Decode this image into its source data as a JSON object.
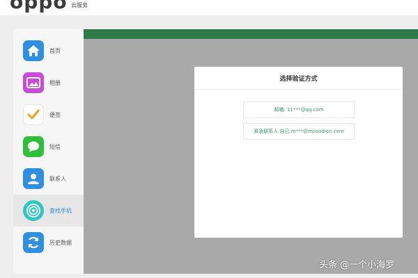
{
  "header": {
    "logo": "oppo",
    "subtitle": "云服务"
  },
  "sidebar": {
    "items": [
      {
        "label": "首页",
        "icon": "home-icon",
        "color": "#2f8fe0"
      },
      {
        "label": "相册",
        "icon": "photo-icon",
        "color": "#c94bd8"
      },
      {
        "label": "便签",
        "icon": "note-check-icon",
        "color": "#ffffff"
      },
      {
        "label": "短信",
        "icon": "message-icon",
        "color": "#2fbf3a"
      },
      {
        "label": "联系人",
        "icon": "contact-icon",
        "color": "#2f8fe0"
      },
      {
        "label": "查找手机",
        "icon": "find-phone-icon",
        "color": "#2fc7c4",
        "active": true
      },
      {
        "label": "历史数据",
        "icon": "history-sync-icon",
        "color": "#2f8fe0"
      }
    ]
  },
  "modal": {
    "title": "选择验证方式",
    "options": [
      "邮箱: 11***@qq.com",
      "紧急联系人 自己.m***@mjiaodien.com"
    ]
  },
  "watermark": "头条 @一个小海罗",
  "colors": {
    "accent_green": "#2e7a4a",
    "option_text": "#3a9a6a",
    "overlay_gray": "#a9a9a9"
  }
}
